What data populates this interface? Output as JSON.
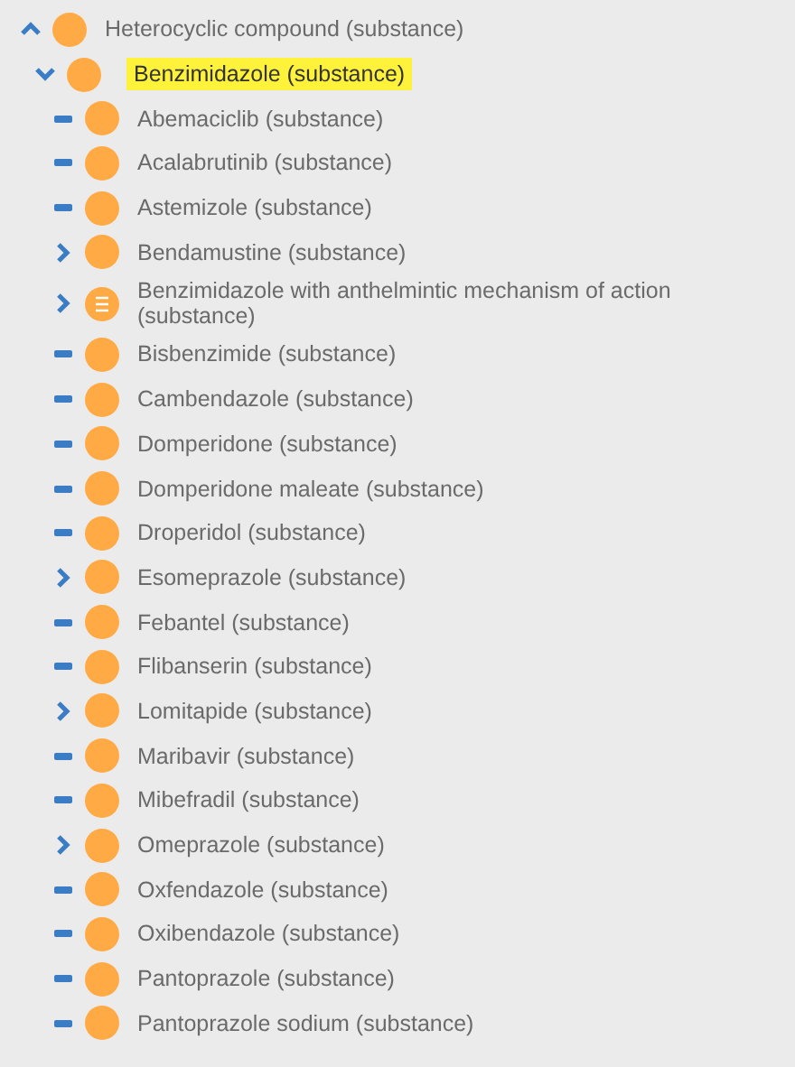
{
  "tree": [
    {
      "label": "Heterocyclic compound (substance)",
      "kind": "ancestor",
      "fully_defined": false,
      "selected": false,
      "children": [
        {
          "label": "Benzimidazole (substance)",
          "kind": "expanded",
          "fully_defined": false,
          "selected": true,
          "children": [
            {
              "label": "Abemaciclib (substance)",
              "kind": "leaf",
              "fully_defined": false,
              "selected": false
            },
            {
              "label": "Acalabrutinib (substance)",
              "kind": "leaf",
              "fully_defined": false,
              "selected": false
            },
            {
              "label": "Astemizole (substance)",
              "kind": "leaf",
              "fully_defined": false,
              "selected": false
            },
            {
              "label": "Bendamustine (substance)",
              "kind": "collapsed",
              "fully_defined": false,
              "selected": false
            },
            {
              "label": "Benzimidazole with anthelmintic mechanism of action (substance)",
              "kind": "collapsed",
              "fully_defined": true,
              "selected": false
            },
            {
              "label": "Bisbenzimide (substance)",
              "kind": "leaf",
              "fully_defined": false,
              "selected": false
            },
            {
              "label": "Cambendazole (substance)",
              "kind": "leaf",
              "fully_defined": false,
              "selected": false
            },
            {
              "label": "Domperidone (substance)",
              "kind": "leaf",
              "fully_defined": false,
              "selected": false
            },
            {
              "label": "Domperidone maleate (substance)",
              "kind": "leaf",
              "fully_defined": false,
              "selected": false
            },
            {
              "label": "Droperidol (substance)",
              "kind": "leaf",
              "fully_defined": false,
              "selected": false
            },
            {
              "label": "Esomeprazole (substance)",
              "kind": "collapsed",
              "fully_defined": false,
              "selected": false
            },
            {
              "label": "Febantel (substance)",
              "kind": "leaf",
              "fully_defined": false,
              "selected": false
            },
            {
              "label": "Flibanserin (substance)",
              "kind": "leaf",
              "fully_defined": false,
              "selected": false
            },
            {
              "label": "Lomitapide (substance)",
              "kind": "collapsed",
              "fully_defined": false,
              "selected": false
            },
            {
              "label": "Maribavir (substance)",
              "kind": "leaf",
              "fully_defined": false,
              "selected": false
            },
            {
              "label": "Mibefradil (substance)",
              "kind": "leaf",
              "fully_defined": false,
              "selected": false
            },
            {
              "label": "Omeprazole (substance)",
              "kind": "collapsed",
              "fully_defined": false,
              "selected": false
            },
            {
              "label": "Oxfendazole (substance)",
              "kind": "leaf",
              "fully_defined": false,
              "selected": false
            },
            {
              "label": "Oxibendazole (substance)",
              "kind": "leaf",
              "fully_defined": false,
              "selected": false
            },
            {
              "label": "Pantoprazole (substance)",
              "kind": "leaf",
              "fully_defined": false,
              "selected": false
            },
            {
              "label": "Pantoprazole sodium (substance)",
              "kind": "leaf",
              "fully_defined": false,
              "selected": false
            }
          ]
        }
      ]
    }
  ]
}
